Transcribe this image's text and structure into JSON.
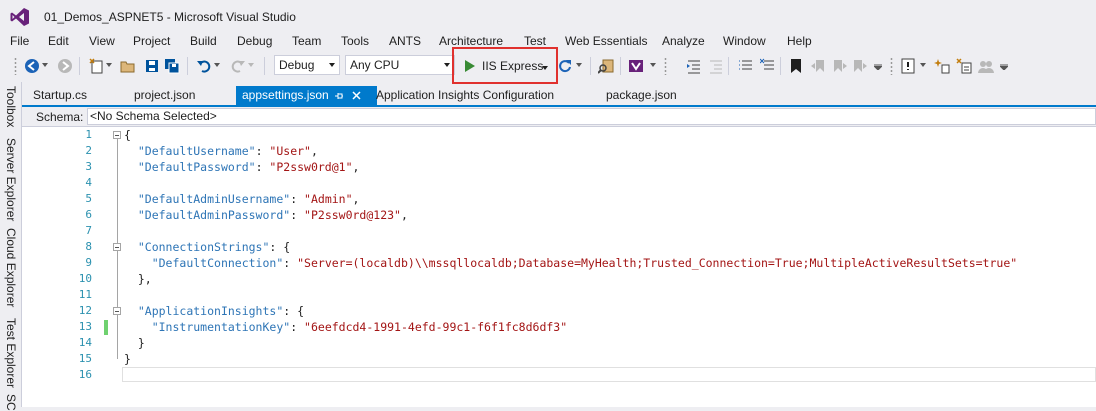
{
  "window": {
    "title": "01_Demos_ASPNET5 - Microsoft Visual Studio"
  },
  "menu": [
    "File",
    "Edit",
    "View",
    "Project",
    "Build",
    "Debug",
    "Team",
    "Tools",
    "ANTS",
    "Architecture",
    "Test",
    "Web Essentials",
    "Analyze",
    "Window",
    "Help"
  ],
  "toolbar": {
    "config": "Debug",
    "platform": "Any CPU",
    "run_label": "IIS Express"
  },
  "tabs": [
    "Startup.cs",
    "project.json",
    "appsettings.json",
    "Application Insights Configuration",
    "package.json"
  ],
  "active_tab": "appsettings.json",
  "side_panels": [
    "Toolbox",
    "Server Explorer",
    "Cloud Explorer",
    "Test Explorer",
    "SC"
  ],
  "schema": {
    "label": "Schema:",
    "value": "<No Schema Selected>"
  },
  "editor": {
    "line_numbers": [
      "1",
      "2",
      "3",
      "4",
      "5",
      "6",
      "7",
      "8",
      "9",
      "10",
      "11",
      "12",
      "13",
      "14",
      "15",
      "16"
    ],
    "lines": {
      "l1": "{",
      "l2k": "\"DefaultUsername\"",
      "l2v": "\"User\"",
      "l3k": "\"DefaultPassword\"",
      "l3v": "\"P2ssw0rd@1\"",
      "l5k": "\"DefaultAdminUsername\"",
      "l5v": "\"Admin\"",
      "l6k": "\"DefaultAdminPassword\"",
      "l6v": "\"P2ssw0rd@123\"",
      "l8k": "\"ConnectionStrings\"",
      "l9k": "\"DefaultConnection\"",
      "l9v": "\"Server=(localdb)\\\\mssqllocaldb;Database=MyHealth;Trusted_Connection=True;MultipleActiveResultSets=true\"",
      "l10": "},",
      "l12k": "\"ApplicationInsights\"",
      "l13k": "\"InstrumentationKey\"",
      "l13v": "\"6eefdcd4-1991-4efd-99c1-f6f1fc8d6df3\"",
      "l14": "}",
      "l15": "}"
    }
  },
  "colors": {
    "accent": "#007acc",
    "highlight": "#e0312e",
    "string": "#a31515",
    "key": "#2e75b6"
  }
}
